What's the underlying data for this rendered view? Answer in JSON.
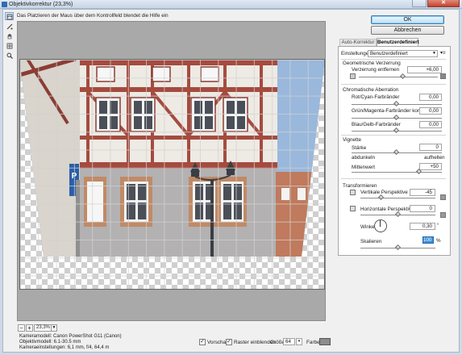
{
  "window": {
    "title": "Objektivkorrektur (23,3%)",
    "close_glyph": "✕"
  },
  "hint": "Das Platzieren der Maus über dem Kontrollfeld blendet die Hilfe ein",
  "tools": [
    "distortion-tool-icon",
    "straighten-tool-icon",
    "hand-tool-icon",
    "move-grid-tool-icon",
    "zoom-tool-icon"
  ],
  "zoom": {
    "minus": "−",
    "plus": "+",
    "value": "23,3%",
    "arrow": "▼"
  },
  "info": {
    "camera": "Kameramodell: Canon PowerShot G11 (Canon)",
    "lens": "Objektivmodell: 6.1-30.5 mm",
    "settings": "Kameraeinstellungen: 6,1 mm, f/4, 64,4 m"
  },
  "bottom": {
    "preview_label": "Vorschau",
    "preview_checked": "✓",
    "grid_label": "Raster einblenden",
    "grid_checked": "✓",
    "size_label": "Größe:",
    "size_value": "64",
    "color_label": "Farbe:",
    "color": "#8c8c8c"
  },
  "buttons": {
    "ok": "OK",
    "cancel": "Abbrechen"
  },
  "tabs": {
    "auto": "Auto-Korrektur",
    "custom": "Benutzerdefiniert"
  },
  "panel": {
    "settings_label": "Einstellungen:",
    "settings_value": "Benutzerdefiniert",
    "settings_arrow": "▼",
    "menu_glyph": "▾≡",
    "geo_title": "Geometrische Verzerrung",
    "distortion_label": "Verzerrung entfernen",
    "distortion_value": "+6,00",
    "chroma_title": "Chromatische Aberration",
    "rc_label": "Rot/Cyan-Farbränder",
    "rc_value": "0,00",
    "gm_label": "Grün/Magenta-Farbränder korrig.",
    "gm_value": "0,00",
    "by_label": "Blau/Gelb-Farbränder",
    "by_value": "0,00",
    "vignette_title": "Vignette",
    "strength_label": "Stärke",
    "strength_value": "0",
    "darken_label": "abdunkeln",
    "lighten_label": "aufhellen",
    "midpoint_label": "Mittenwert",
    "midpoint_value": "+50",
    "transform_title": "Transformieren",
    "vperspective_label": "Vertikale Perspektive",
    "vperspective_value": "-45",
    "hperspective_label": "Horizontale Perspektive",
    "hperspective_value": "0",
    "angle_label": "Winkel:",
    "angle_value": "0,30",
    "angle_unit": "°",
    "scale_label": "Skalieren",
    "scale_value": "100",
    "scale_unit": "%"
  },
  "sliders": {
    "distortion": 0.56,
    "rc": 0.5,
    "gm": 0.5,
    "by": 0.5,
    "strength": 0.5,
    "midpoint": 0.75,
    "vperspective": 0.28,
    "hperspective": 0.5,
    "scale": 0.5
  },
  "colors": {
    "accent": "#3c7fb1",
    "panel_bg": "#ffffff",
    "canvas_bg": "#a9a9a9"
  }
}
